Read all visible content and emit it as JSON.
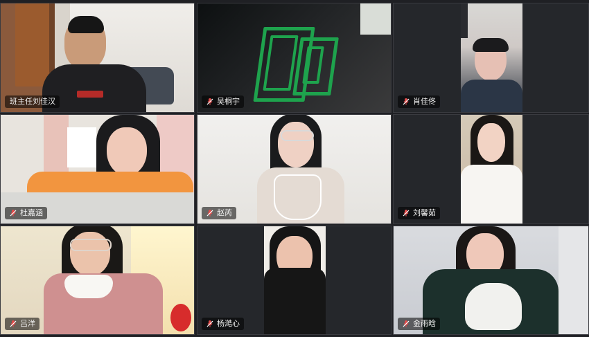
{
  "meeting": {
    "participants": [
      {
        "id": "p1",
        "name": "班主任刘佳汉",
        "muted": false
      },
      {
        "id": "p2",
        "name": "吴桐宇",
        "muted": true
      },
      {
        "id": "p3",
        "name": "肖佳佟",
        "muted": true
      },
      {
        "id": "p4",
        "name": "杜嘉涵",
        "muted": true
      },
      {
        "id": "p5",
        "name": "赵芮",
        "muted": true
      },
      {
        "id": "p6",
        "name": "刘馨茹",
        "muted": true
      },
      {
        "id": "p7",
        "name": "吕洋",
        "muted": true
      },
      {
        "id": "p8",
        "name": "杨澔心",
        "muted": true
      },
      {
        "id": "p9",
        "name": "金雨晗",
        "muted": true
      }
    ],
    "navigation": {
      "next_page": "›"
    }
  },
  "colors": {
    "background": "#1f2024",
    "tile": "#2b2c31",
    "muted_icon": "#e34b4b"
  },
  "icons": {
    "muted": "muted-microphone-icon",
    "next": "chevron-right-icon"
  }
}
